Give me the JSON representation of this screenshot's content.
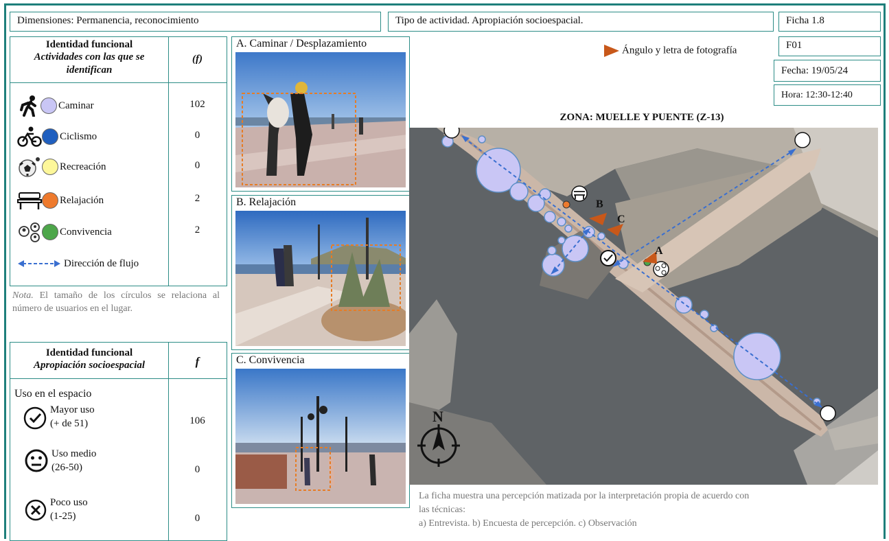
{
  "header": {
    "dimensions": "Dimensiones: Permanencia, reconocimiento",
    "activity_type": "Tipo de actividad. Apropiación socioespacial.",
    "sheet": "Ficha 1.8",
    "code": "F01",
    "date": "Fecha: 19/05/24",
    "time": "Hora: 12:30-12:40"
  },
  "table1": {
    "title": "Identidad funcional",
    "subtitle": "Actividades con las que se identifican",
    "col_header": "(f)",
    "rows": [
      {
        "label": "Caminar",
        "value": "102",
        "icon": "walking-person-icon",
        "color": "#c9c6f5"
      },
      {
        "label": "Ciclismo",
        "value": "0",
        "icon": "bicycle-icon",
        "color": "#1f5fbf"
      },
      {
        "label": "Recreación",
        "value": "0",
        "icon": "soccer-ball-icon",
        "color": "#fdf79a"
      },
      {
        "label": "Relajación",
        "value": "2",
        "icon": "bench-icon",
        "color": "#ee7a2d"
      },
      {
        "label": "Convivencia",
        "value": "2",
        "icon": "people-network-icon",
        "color": "#4da64a"
      }
    ],
    "flow_label": "Dirección de flujo"
  },
  "note": {
    "prefix": "Nota.",
    "text": " El tamaño de los círculos se relaciona al número de usuarios en el lugar."
  },
  "table2": {
    "title": "Identidad funcional",
    "subtitle": "Apropiación socioespacial",
    "col_header": "f",
    "section": "Uso en el espacio",
    "rows": [
      {
        "label1": "Mayor uso",
        "label2": "(+ de 51)",
        "value": "106",
        "icon": "check-circle-icon"
      },
      {
        "label1": "Uso medio",
        "label2": "(26-50)",
        "value": "0",
        "icon": "neutral-face-icon"
      },
      {
        "label1": "Poco uso",
        "label2": "(1-25)",
        "value": "0",
        "icon": "x-circle-icon"
      }
    ]
  },
  "photos": [
    {
      "title": "A. Caminar / Desplazamiento"
    },
    {
      "title": "B. Relajación"
    },
    {
      "title": "C. Convivencia"
    }
  ],
  "map": {
    "legend": "Ángulo y letra de fotografía",
    "zone": "ZONA: MUELLE Y PUENTE (Z-13)",
    "north": "N",
    "markers": [
      "A",
      "B",
      "C"
    ],
    "colors": {
      "accent": "#1e7f7b",
      "arrow": "#c8581a",
      "flow": "#3a6fd0",
      "circle": "#c9c6f5"
    }
  },
  "caption": {
    "line1": "La ficha muestra una percepción matizada por la interpretación propia de acuerdo con",
    "line2": "las técnicas:",
    "line3": "a) Entrevista. b) Encuesta de percepción. c) Observación"
  }
}
